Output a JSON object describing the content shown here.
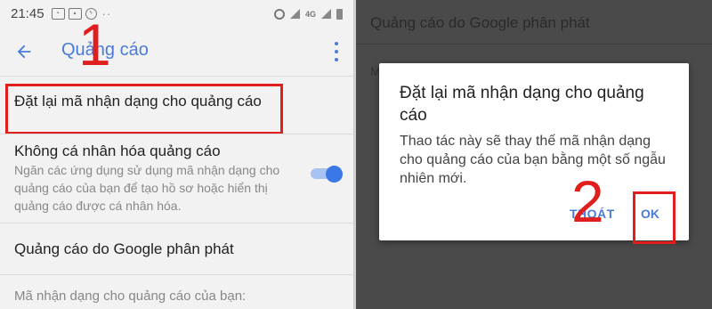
{
  "left": {
    "status": {
      "time": "21:45",
      "icons": [
        "sim-card-icon",
        "image-icon",
        "messenger-icon"
      ],
      "more": "··",
      "network": "4G"
    },
    "toolbar": {
      "title": "Quảng cáo"
    },
    "annotation_number": "1",
    "items": [
      {
        "title": "Đặt lại mã nhận dạng cho quảng cáo"
      },
      {
        "title": "Không cá nhân hóa quảng cáo",
        "subtitle": "Ngăn các ứng dụng sử dụng mã nhận dạng cho quảng cáo của bạn để tạo hồ sơ hoặc hiển thị quảng cáo được cá nhân hóa.",
        "toggle_on": true
      },
      {
        "title": "Quảng cáo do Google phân phát"
      },
      {
        "title": "Mã nhận dạng cho quảng cáo của bạn:"
      }
    ]
  },
  "right": {
    "background_title": "Quảng cáo do Google phân phát",
    "background_fragment": "M",
    "dialog": {
      "title": "Đặt lại mã nhận dạng cho quảng cáo",
      "message": "Thao tác này sẽ thay thế mã nhận dạng cho quảng cáo của bạn bằng một số ngẫu nhiên mới.",
      "cancel_label": "THOÁT",
      "ok_label": "OK"
    },
    "annotation_number": "2"
  },
  "colors": {
    "accent": "#4a7bd8",
    "annotation": "#e01e1e",
    "toggle": "#3b78e7"
  }
}
